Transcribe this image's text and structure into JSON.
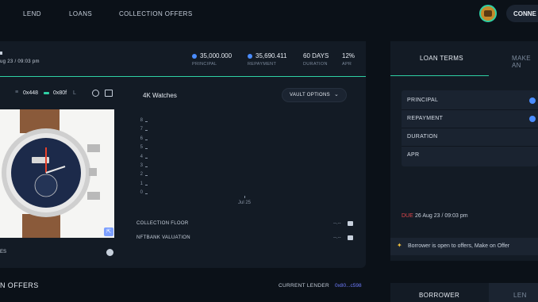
{
  "nav": {
    "links": [
      "LEND",
      "LOANS",
      "COLLECTION OFFERS"
    ],
    "connect_label": "CONNE"
  },
  "loan": {
    "date_partial": "ug 23 / 09:03 pm",
    "principal": {
      "value": "35,000.000",
      "label": "PRINCIPAL"
    },
    "repayment": {
      "value": "35,690.411",
      "label": "REPAYMENT"
    },
    "duration": {
      "value": "60 DAYS",
      "label": "DURATION"
    },
    "apr": {
      "value": "12%",
      "label": "APR"
    }
  },
  "addresses": {
    "first": "0x448",
    "second": "0x80f",
    "second_suffix": "L"
  },
  "collection": {
    "name": "4K Watches",
    "vault_options_label": "VAULT OPTIONS",
    "partial_label": "ES"
  },
  "chart_data": {
    "type": "line",
    "y_ticks": [
      "8",
      "7",
      "6",
      "5",
      "4",
      "3",
      "2",
      "1",
      "0"
    ],
    "x_ticks": [
      "Jul 25"
    ],
    "series": []
  },
  "valuation": {
    "rows": [
      {
        "label": "COLLECTION FLOOR",
        "value": "--.--"
      },
      {
        "label": "NFTBANK VALUATION",
        "value": "--.--"
      }
    ]
  },
  "terms": {
    "tabs": [
      "LOAN TERMS",
      "MAKE AN"
    ],
    "rows": [
      "PRINCIPAL",
      "REPAYMENT",
      "DURATION",
      "APR"
    ],
    "due_label": "DUE",
    "due_date": "26 Aug 23 / 09:03 pm",
    "offer_message": "Borrower is open to offers, Make on Offer"
  },
  "offers": {
    "title_partial": "N OFFERS",
    "current_lender_label": "CURRENT LENDER",
    "current_lender_value": "0x80...c598"
  },
  "bottom_tabs": [
    "BORROWER",
    "LEN"
  ],
  "colors": {
    "accent": "#2fd0a4",
    "blue": "#4a8cff",
    "due": "#e0474c",
    "link": "#6f7dff"
  }
}
